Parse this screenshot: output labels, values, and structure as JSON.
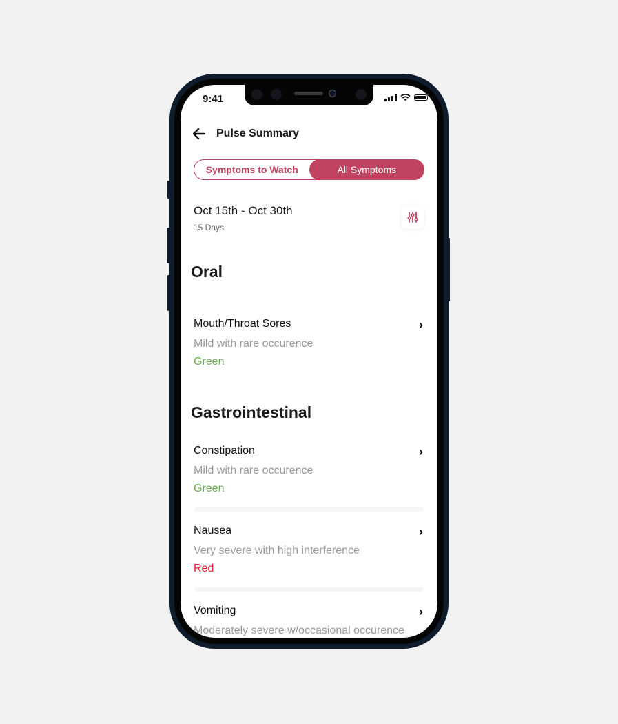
{
  "status_bar": {
    "time": "9:41"
  },
  "header": {
    "back_icon": "arrow-left-icon",
    "title": "Pulse Summary"
  },
  "toggle": {
    "options": [
      "Symptoms to Watch",
      "All Symptoms"
    ],
    "selected": "All Symptoms"
  },
  "range": {
    "dates": "Oct 15th - Oct 30th",
    "duration": "15 Days",
    "filter_icon": "sliders-icon"
  },
  "colors": {
    "accent": "#c04360",
    "green": "#6ab04c",
    "red": "#e8202e"
  },
  "sections": [
    {
      "title": "Oral",
      "items": [
        {
          "name": "Mouth/Throat Sores",
          "description": "Mild with rare occurence",
          "level": "Green"
        }
      ]
    },
    {
      "title": "Gastrointestinal",
      "items": [
        {
          "name": "Constipation",
          "description": "Mild with rare occurence",
          "level": "Green"
        },
        {
          "name": "Nausea",
          "description": "Very severe with high interference",
          "level": "Red"
        },
        {
          "name": "Vomiting",
          "description": "Moderately severe w/occasional occurence",
          "level": ""
        }
      ]
    }
  ]
}
